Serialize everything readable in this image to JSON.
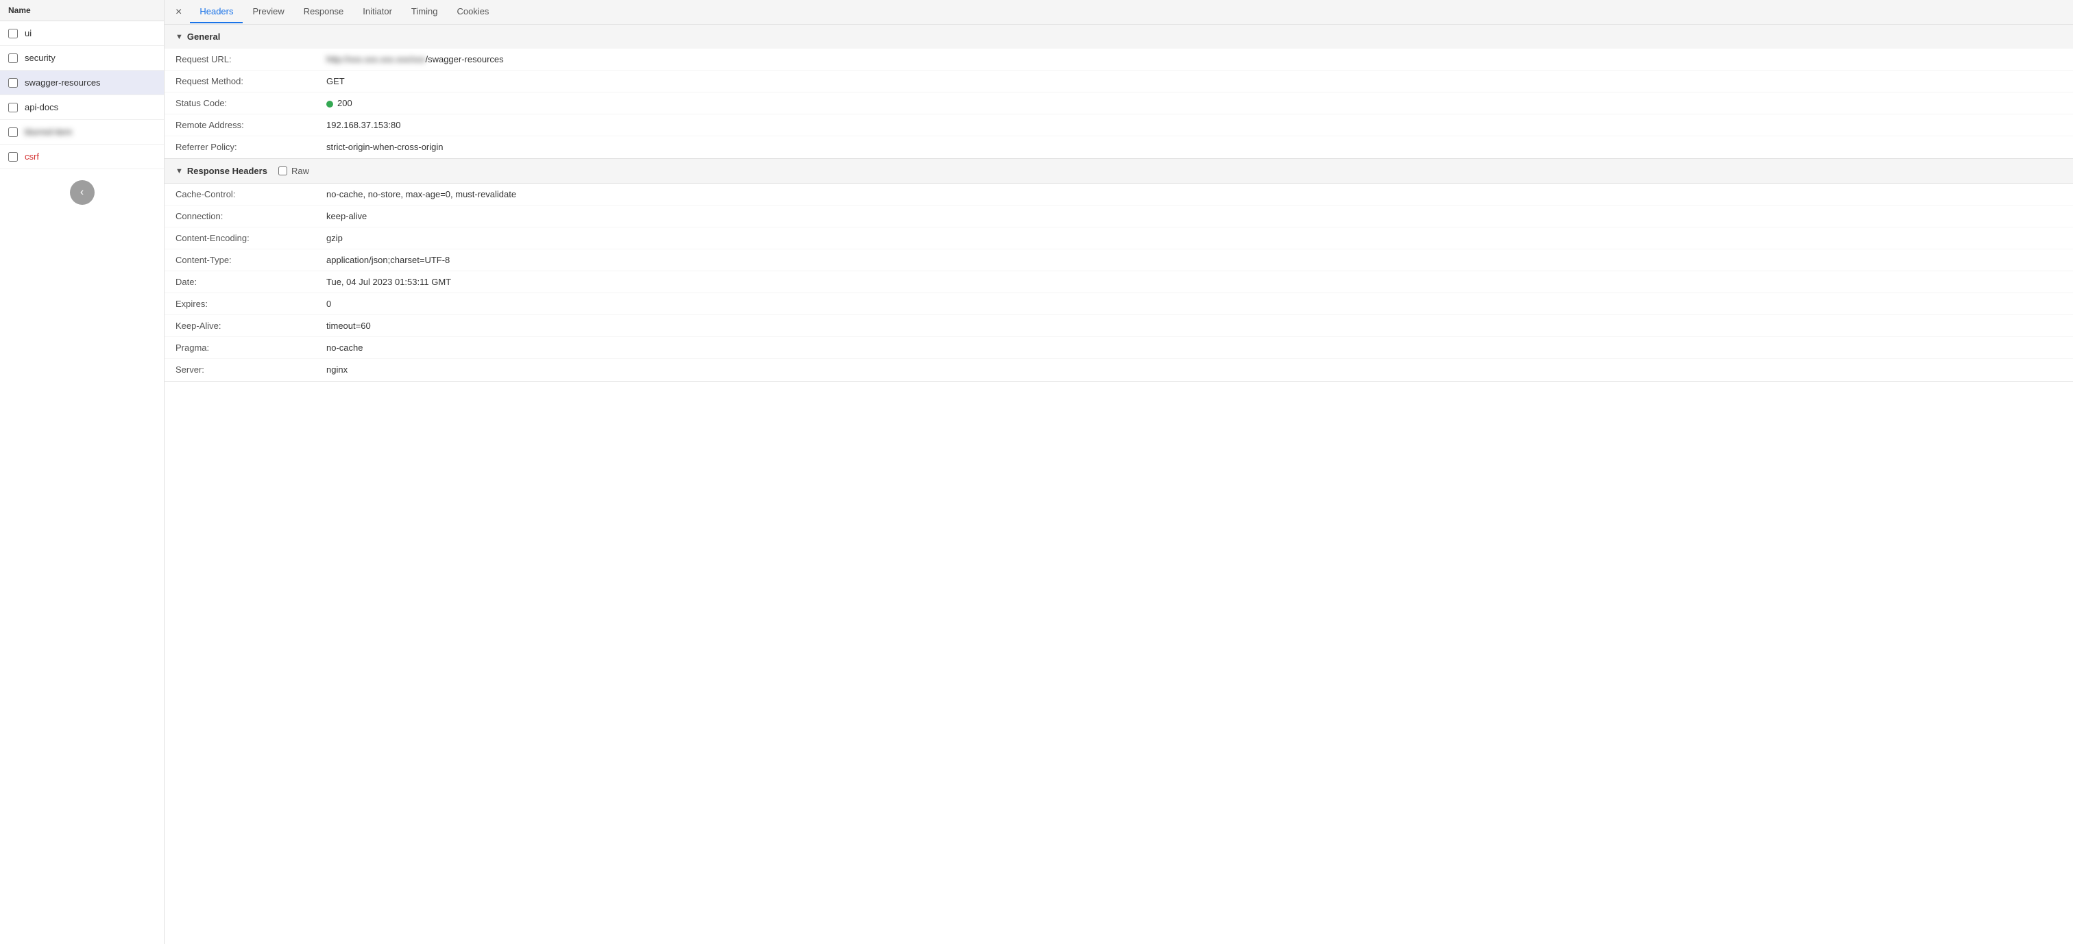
{
  "left_panel": {
    "header": "Name",
    "items": [
      {
        "id": "ui",
        "label": "ui",
        "selected": false,
        "blurred": false,
        "red": false
      },
      {
        "id": "security",
        "label": "security",
        "selected": false,
        "blurred": false,
        "red": false
      },
      {
        "id": "swagger-resources",
        "label": "swagger-resources",
        "selected": true,
        "blurred": false,
        "red": false
      },
      {
        "id": "api-docs",
        "label": "api-docs",
        "selected": false,
        "blurred": false,
        "red": false
      },
      {
        "id": "blurred-item",
        "label": "blurred-item",
        "selected": false,
        "blurred": true,
        "red": false
      },
      {
        "id": "csrf",
        "label": "csrf",
        "selected": false,
        "blurred": false,
        "red": true
      }
    ],
    "collapse_btn": "‹"
  },
  "tabs": {
    "close_label": "×",
    "items": [
      {
        "id": "headers",
        "label": "Headers",
        "active": true
      },
      {
        "id": "preview",
        "label": "Preview",
        "active": false
      },
      {
        "id": "response",
        "label": "Response",
        "active": false
      },
      {
        "id": "initiator",
        "label": "Initiator",
        "active": false
      },
      {
        "id": "timing",
        "label": "Timing",
        "active": false
      },
      {
        "id": "cookies",
        "label": "Cookies",
        "active": false
      }
    ]
  },
  "general_section": {
    "title": "▼ General",
    "rows": [
      {
        "name": "Request URL:",
        "value": "/swagger-resources",
        "blurred": false,
        "has_blurred_prefix": true,
        "prefix_placeholder": "http://xxx.xxx.xxx.xxx/xxx"
      },
      {
        "name": "Request Method:",
        "value": "GET",
        "blurred": false
      },
      {
        "name": "Status Code:",
        "value": "200",
        "blurred": false,
        "has_status_dot": true
      },
      {
        "name": "Remote Address:",
        "value": "192.168.37.153:80",
        "blurred": false
      },
      {
        "name": "Referrer Policy:",
        "value": "strict-origin-when-cross-origin",
        "blurred": false
      }
    ]
  },
  "response_headers_section": {
    "title": "▼ Response Headers",
    "raw_label": "Raw",
    "rows": [
      {
        "name": "Cache-Control:",
        "value": "no-cache, no-store, max-age=0, must-revalidate"
      },
      {
        "name": "Connection:",
        "value": "keep-alive"
      },
      {
        "name": "Content-Encoding:",
        "value": "gzip"
      },
      {
        "name": "Content-Type:",
        "value": "application/json;charset=UTF-8"
      },
      {
        "name": "Date:",
        "value": "Tue, 04 Jul 2023 01:53:11 GMT"
      },
      {
        "name": "Expires:",
        "value": "0"
      },
      {
        "name": "Keep-Alive:",
        "value": "timeout=60"
      },
      {
        "name": "Pragma:",
        "value": "no-cache"
      },
      {
        "name": "Server:",
        "value": "nginx"
      }
    ]
  },
  "colors": {
    "status_green": "#34a853",
    "active_tab_blue": "#1a73e8",
    "selected_bg": "#e8eaf6"
  }
}
